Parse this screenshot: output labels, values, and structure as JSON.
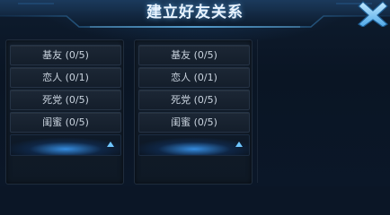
{
  "dialog": {
    "title": "建立好友关系"
  },
  "groups": [
    {
      "items": [
        {
          "label": "基友 (0/5)"
        },
        {
          "label": "恋人 (0/1)"
        },
        {
          "label": "死党 (0/5)"
        },
        {
          "label": "闺蜜 (0/5)"
        }
      ]
    },
    {
      "items": [
        {
          "label": "基友 (0/5)"
        },
        {
          "label": "恋人 (0/1)"
        },
        {
          "label": "死党 (0/5)"
        },
        {
          "label": "闺蜜 (0/5)"
        }
      ]
    }
  ],
  "icons": {
    "close": "close-icon",
    "collapse": "chevron-up-icon"
  },
  "colors": {
    "accent": "#2f9bff",
    "background": "#0b1626",
    "text": "#c9d3de"
  }
}
